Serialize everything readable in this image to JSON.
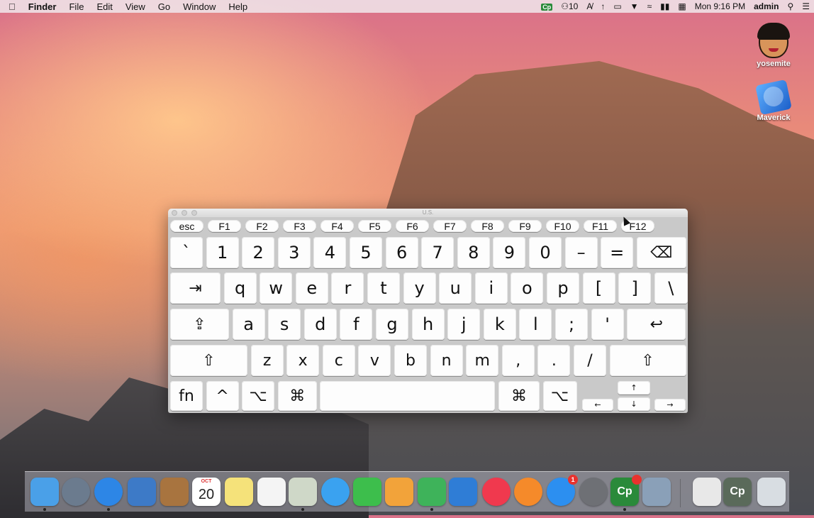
{
  "menubar": {
    "apple": "",
    "app_name": "Finder",
    "menus": [
      "File",
      "Edit",
      "View",
      "Go",
      "Window",
      "Help"
    ],
    "status": {
      "cp_label": "Cp",
      "notifications_count": "10",
      "clock": "Mon 9:16 PM",
      "user": "admin"
    }
  },
  "desktop_icons": [
    {
      "label": "yosemite",
      "icon": "user-avatar-icon"
    },
    {
      "label": "Maverick",
      "icon": "hard-drive-icon"
    }
  ],
  "keyboard_viewer": {
    "title": "U.S.",
    "function_row": [
      "esc",
      "F1",
      "F2",
      "F3",
      "F4",
      "F5",
      "F6",
      "F7",
      "F8",
      "F9",
      "F10",
      "F11",
      "F12"
    ],
    "number_row": [
      "`",
      "1",
      "2",
      "3",
      "4",
      "5",
      "6",
      "7",
      "8",
      "9",
      "0",
      "–",
      "=",
      "⌫"
    ],
    "qwerty_row": [
      "⇥",
      "q",
      "w",
      "e",
      "r",
      "t",
      "y",
      "u",
      "i",
      "o",
      "p",
      "[",
      "]",
      "\\"
    ],
    "home_row": [
      "⇪",
      "a",
      "s",
      "d",
      "f",
      "g",
      "h",
      "j",
      "k",
      "l",
      ";",
      "'",
      "↩"
    ],
    "shift_row": [
      "⇧",
      "z",
      "x",
      "c",
      "v",
      "b",
      "n",
      "m",
      ",",
      ".",
      "/",
      "⇧"
    ],
    "bottom_row": [
      "fn",
      "^",
      "⌥",
      "⌘",
      "",
      "⌘",
      "⌥"
    ],
    "arrows": [
      "←",
      "↑",
      "↓",
      "→"
    ]
  },
  "dock": {
    "items": [
      {
        "name": "finder-icon",
        "color": "#4aa0e8",
        "label": ""
      },
      {
        "name": "launchpad-icon",
        "color": "#6b7b8e",
        "label": ""
      },
      {
        "name": "safari-icon",
        "color": "#2d86e6",
        "label": ""
      },
      {
        "name": "mail-icon",
        "color": "#3d7ac7",
        "label": ""
      },
      {
        "name": "contacts-icon",
        "color": "#a8743f",
        "label": ""
      },
      {
        "name": "calendar-icon",
        "color": "#ffffff",
        "label": "20",
        "month": "OCT"
      },
      {
        "name": "notes-icon",
        "color": "#f5e27a",
        "label": ""
      },
      {
        "name": "reminders-icon",
        "color": "#f4f4f4",
        "label": ""
      },
      {
        "name": "preview-icon",
        "color": "#cfd8c8",
        "label": ""
      },
      {
        "name": "messages-icon",
        "color": "#3aa2f0",
        "label": ""
      },
      {
        "name": "facetime-icon",
        "color": "#3dbe4c",
        "label": ""
      },
      {
        "name": "pages-icon",
        "color": "#f2a33a",
        "label": ""
      },
      {
        "name": "numbers-icon",
        "color": "#3eb35a",
        "label": ""
      },
      {
        "name": "keynote-icon",
        "color": "#2f7dd6",
        "label": ""
      },
      {
        "name": "itunes-icon",
        "color": "#f0394e",
        "label": ""
      },
      {
        "name": "ibooks-icon",
        "color": "#f58a2a",
        "label": ""
      },
      {
        "name": "app-store-icon",
        "color": "#2c8ff0",
        "label": "",
        "badge": "1"
      },
      {
        "name": "system-preferences-icon",
        "color": "#6e7075",
        "label": ""
      },
      {
        "name": "captivate-icon",
        "color": "#2a8a3a",
        "label": "Cp",
        "badge": ""
      },
      {
        "name": "image-capture-icon",
        "color": "#8aa0b8",
        "label": ""
      },
      {
        "name": "documents-icon",
        "color": "#e8e8e8",
        "label": ""
      },
      {
        "name": "minimized-window-icon",
        "color": "#5a6a5a",
        "label": "Cp"
      },
      {
        "name": "trash-icon",
        "color": "#d8dde2",
        "label": ""
      }
    ]
  }
}
